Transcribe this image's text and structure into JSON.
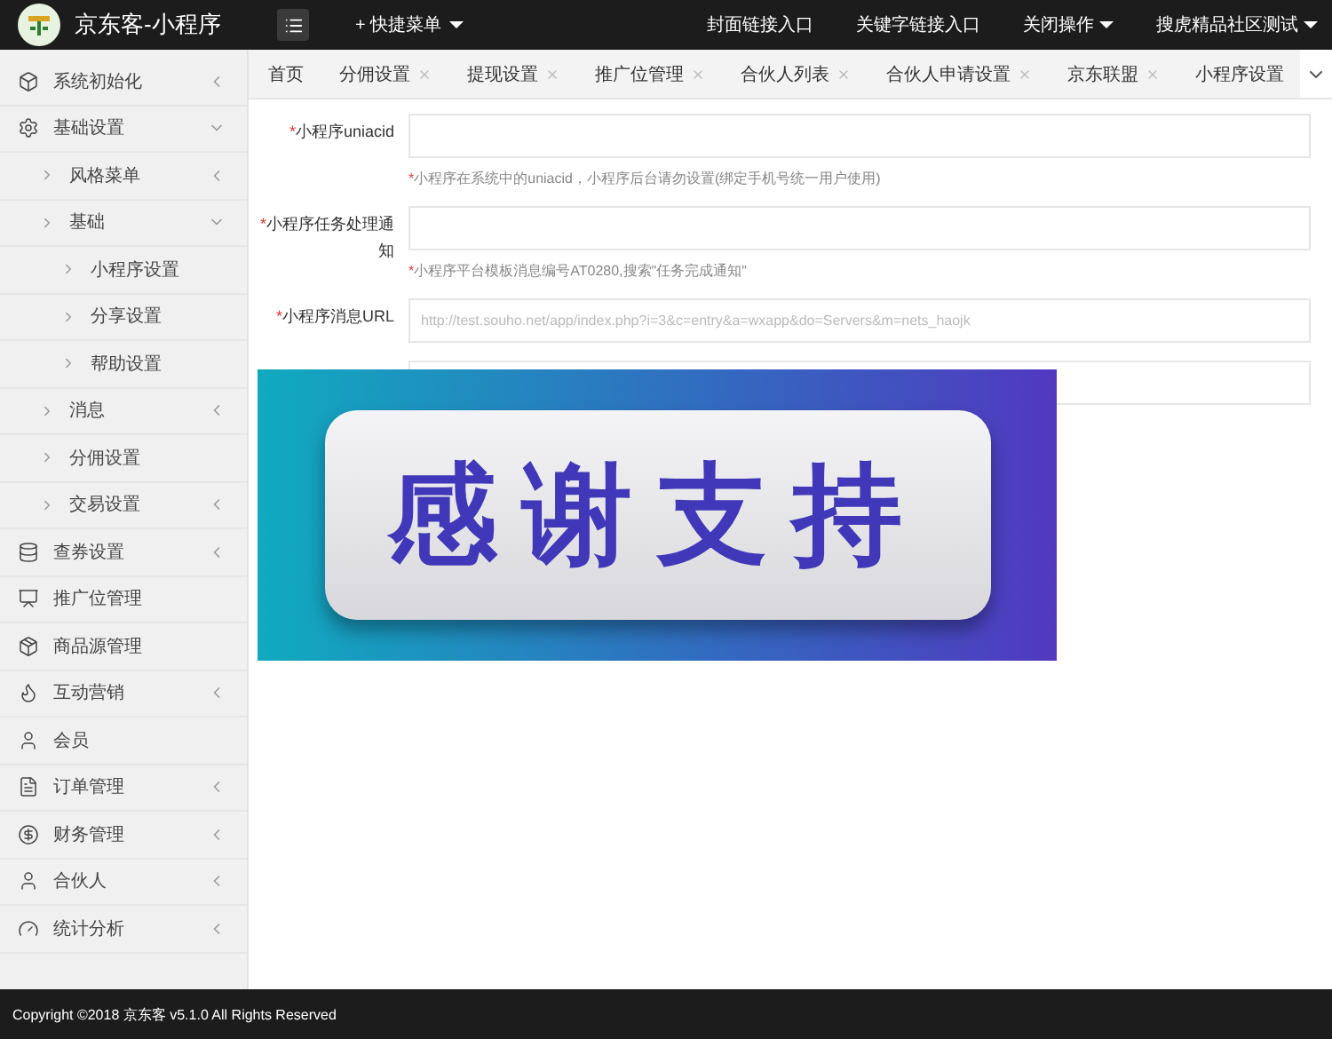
{
  "header": {
    "title": "京东客-小程序",
    "quick_menu": "+ 快捷菜单",
    "links": [
      {
        "label": "封面链接入口",
        "dropdown": false
      },
      {
        "label": "关键字链接入口",
        "dropdown": false
      },
      {
        "label": "关闭操作",
        "dropdown": true
      },
      {
        "label": "搜虎精品社区测试",
        "dropdown": true
      }
    ]
  },
  "sidebar": {
    "items": [
      {
        "label": "系统初始化",
        "expanded": false
      },
      {
        "label": "基础设置",
        "expanded": true,
        "children": [
          {
            "label": "风格菜单",
            "expanded": false
          },
          {
            "label": "基础",
            "expanded": true,
            "children": [
              {
                "label": "小程序设置"
              },
              {
                "label": "分享设置"
              },
              {
                "label": "帮助设置"
              }
            ]
          },
          {
            "label": "消息",
            "expanded": false
          },
          {
            "label": "分佣设置"
          },
          {
            "label": "交易设置",
            "expanded": false
          }
        ]
      },
      {
        "label": "查券设置",
        "expanded": false
      },
      {
        "label": "推广位管理"
      },
      {
        "label": "商品源管理"
      },
      {
        "label": "互动营销",
        "expanded": false
      },
      {
        "label": "会员"
      },
      {
        "label": "订单管理",
        "expanded": false
      },
      {
        "label": "财务管理",
        "expanded": false
      },
      {
        "label": "合伙人",
        "expanded": false
      },
      {
        "label": "统计分析",
        "expanded": false
      }
    ]
  },
  "tabs": [
    {
      "label": "首页",
      "closable": false,
      "selected": false
    },
    {
      "label": "分佣设置",
      "closable": true,
      "selected": false
    },
    {
      "label": "提现设置",
      "closable": true,
      "selected": false
    },
    {
      "label": "推广位管理",
      "closable": true,
      "selected": false
    },
    {
      "label": "合伙人列表",
      "closable": true,
      "selected": false
    },
    {
      "label": "合伙人申请设置",
      "closable": true,
      "selected": false
    },
    {
      "label": "京东联盟",
      "closable": true,
      "selected": false
    },
    {
      "label": "小程序设置",
      "closable": false,
      "selected": false
    }
  ],
  "form": {
    "fields": [
      {
        "mark": "*",
        "label": "小程序uniacid",
        "hint_mark": "*",
        "hint": "小程序在系统中的uniacid，小程序后台请勿设置(绑定手机号统一用户使用)"
      },
      {
        "mark": "*",
        "label": "小程序任务处理通知",
        "hint_mark": "*",
        "hint": "小程序平台模板消息编号AT0280,搜索\"任务完成通知\""
      },
      {
        "mark": "*",
        "label": "小程序消息URL",
        "placeholder": "http://test.souho.net/app/index.php?i=3&c=entry&a=wxapp&do=Servers&m=nets_haojk"
      }
    ],
    "more_input": true
  },
  "overlay_banner": {
    "text": "感谢支持"
  },
  "footer": {
    "text": "Copyright ©2018 京东客 v5.1.0 All Rights Reserved"
  }
}
